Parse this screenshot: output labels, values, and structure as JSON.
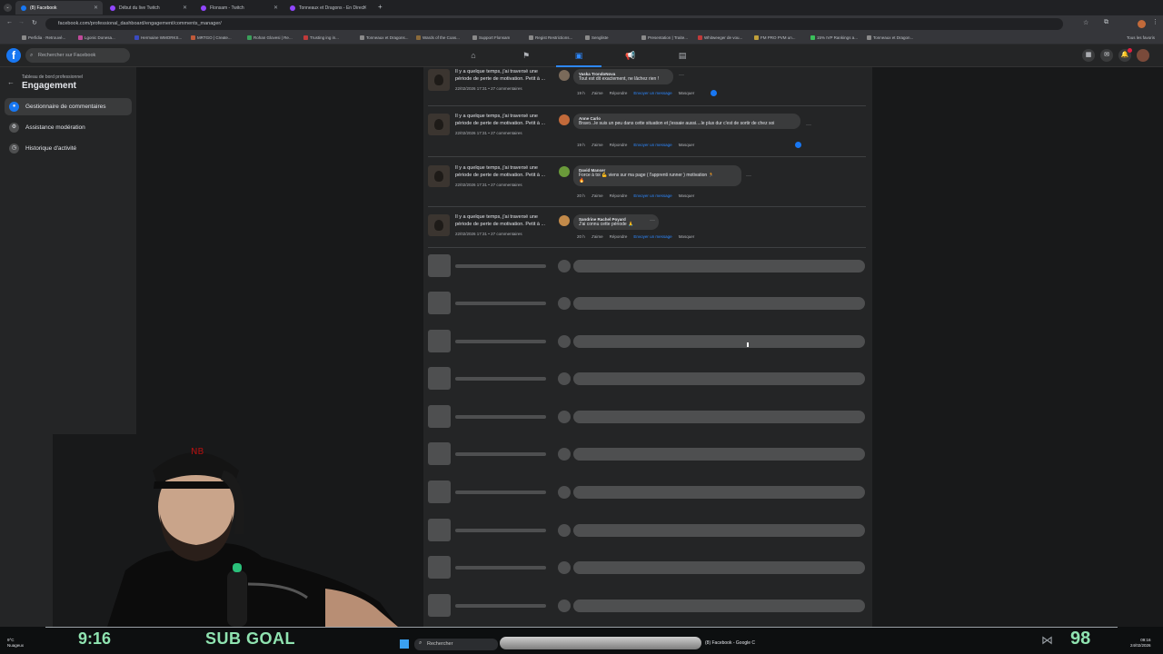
{
  "browser": {
    "tabs": [
      {
        "label": "(8) Facebook",
        "active": true,
        "color": "#1877f2"
      },
      {
        "label": "Début du live Twitch",
        "active": false,
        "color": "#9146ff"
      },
      {
        "label": "Flonsam - Twitch",
        "active": false,
        "color": "#9146ff"
      },
      {
        "label": "Tonneaux et Dragons - En Direct",
        "active": false,
        "color": "#9146ff"
      }
    ],
    "url": "facebook.com/professional_dashboard/engagement/comments_manager/",
    "bookmarks": [
      "Perfidia · Retrouvé...",
      "Lgonic Donesa...",
      "Hermaine WMORKS...",
      "MRTGO | Create...",
      "Rohan Glovesi | Re...",
      "Trusting ing in...",
      "Tonneaux et Dragons...",
      "Wards of the Coas...",
      "Support Flonsam",
      "Regist Restrictions...",
      "Sengliste",
      "Presentation | Traite...",
      "Whitweeger de vou...",
      "FM PRO PVM un...",
      "15% IVP Rankings a...",
      "Tonneaux et Dragon..."
    ],
    "bookmarks_right": "Tous les favoris"
  },
  "fb": {
    "logo": "f",
    "search_placeholder": "Rechercher sur Facebook"
  },
  "sidebar": {
    "subtitle": "Tableau de bord professionnel",
    "title": "Engagement",
    "items": [
      {
        "label": "Gestionnaire de commentaires",
        "active": true
      },
      {
        "label": "Assistance modération",
        "active": false
      },
      {
        "label": "Historique d'activité",
        "active": false
      }
    ]
  },
  "comments": [
    {
      "post_text": "Il y a quelque temps, j'ai traversé une période de perte de motivation. Petit à ...",
      "post_meta": "22/02/2026 17:31 • 27 commentaires",
      "author": "Vaska TrondoNova",
      "text": "Tout est dit exactement, ne lâchez rien !",
      "time": "19 h",
      "actions": [
        "J'aime",
        "Répondre",
        "Envoyer un message",
        "Masquer"
      ],
      "avatar_color": "#7a6a5a",
      "liked": true
    },
    {
      "post_text": "Il y a quelque temps, j'ai traversé une période de perte de motivation. Petit à ...",
      "post_meta": "22/02/2026 17:31 • 27 commentaires",
      "author": "Anne Carlo",
      "text": "Bravo...le suis un peu dans cette situation et j'essaie aussi....le plus dur c'est de sortir de chez soi",
      "time": "19 h",
      "actions": [
        "J'aime",
        "Répondre",
        "Envoyer un message",
        "Masquer"
      ],
      "avatar_color": "#c26a3a",
      "liked": true
    },
    {
      "post_text": "Il y a quelque temps, j'ai traversé une période de perte de motivation. Petit à ...",
      "post_meta": "22/02/2026 17:31 • 27 commentaires",
      "author": "David Manser",
      "text": "Force à toi 💪 viens sur ma page ( l'apprenti runner ) motivation 🏃",
      "text2": "🔥",
      "time": "20 h",
      "actions": [
        "J'aime",
        "Répondre",
        "Envoyer un message",
        "Masquer"
      ],
      "avatar_color": "#6a9a3a",
      "liked": false
    },
    {
      "post_text": "Il y a quelque temps, j'ai traversé une période de perte de motivation. Petit à ...",
      "post_meta": "22/02/2026 17:31 • 27 commentaires",
      "author": "Sandrine Rachel Poyard",
      "text": "J'ai connu cette période 🙏",
      "time": "20 h",
      "actions": [
        "J'aime",
        "Répondre",
        "Envoyer un message",
        "Masquer"
      ],
      "avatar_color": "#c28a4a",
      "liked": false
    }
  ],
  "overlay": {
    "timer": "9:16",
    "goal_label": "SUB GOAL",
    "count": "98"
  },
  "taskbar": {
    "search_placeholder": "Rechercher",
    "window_label": "(8) Facebook - Google C",
    "weather_temp": "9°C",
    "weather_desc": "Nuageux",
    "time": "09:16",
    "date": "24/02/2026"
  }
}
